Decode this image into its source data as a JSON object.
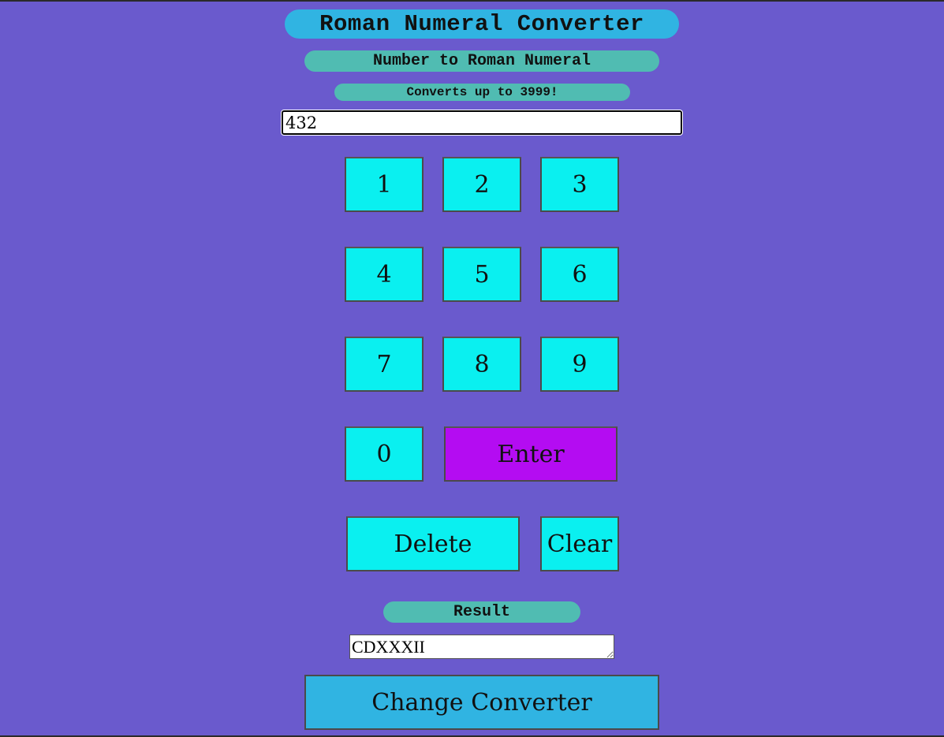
{
  "header": {
    "title": "Roman Numeral Converter",
    "subtitle": "Number to Roman Numeral",
    "note": "Converts up to 3999!"
  },
  "input": {
    "value": "432"
  },
  "keypad": {
    "k1": "1",
    "k2": "2",
    "k3": "3",
    "k4": "4",
    "k5": "5",
    "k6": "6",
    "k7": "7",
    "k8": "8",
    "k9": "9",
    "k0": "0",
    "enter": "Enter",
    "delete": "Delete",
    "clear": "Clear"
  },
  "result": {
    "label": "Result",
    "value": "CDXXXII"
  },
  "footer": {
    "change_label": "Change Converter"
  },
  "colors": {
    "background": "#6a5acd",
    "title_bg": "#30b4e2",
    "label_bg": "#50bcb2",
    "key_bg": "#0af0f0",
    "enter_bg": "#b40cf2"
  }
}
